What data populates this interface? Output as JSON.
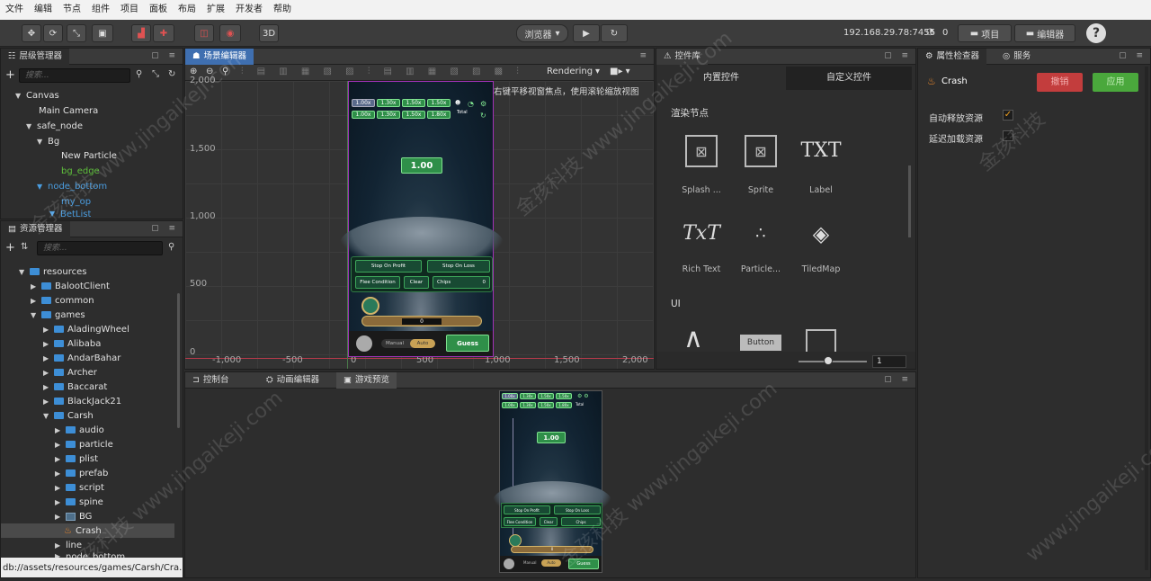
{
  "menu": [
    "文件",
    "编辑",
    "节点",
    "组件",
    "项目",
    "面板",
    "布局",
    "扩展",
    "开发者",
    "帮助"
  ],
  "toolbar": {
    "mode_3d": "3D",
    "browser_select": "浏览器",
    "ip_address": "192.168.29.78:7456",
    "connection_count": "0",
    "project_button": "项目",
    "editor_button": "编辑器"
  },
  "hierarchy": {
    "title": "层级管理器",
    "search_placeholder": "搜索...",
    "items": [
      {
        "label": "Canvas",
        "color": "white"
      },
      {
        "label": "Main Camera",
        "color": "white"
      },
      {
        "label": "safe_node",
        "color": "white"
      },
      {
        "label": "Bg",
        "color": "white"
      },
      {
        "label": "New Particle",
        "color": "white"
      },
      {
        "label": "bg_edge",
        "color": "green"
      },
      {
        "label": "node_bottom",
        "color": "blue"
      },
      {
        "label": "my_op",
        "color": "blue"
      },
      {
        "label": "BetList",
        "color": "blue"
      }
    ]
  },
  "assets": {
    "title": "资源管理器",
    "search_placeholder": "搜索...",
    "items": [
      {
        "label": "resources",
        "type": "folder"
      },
      {
        "label": "BalootClient",
        "type": "folder"
      },
      {
        "label": "common",
        "type": "folder"
      },
      {
        "label": "games",
        "type": "folder"
      },
      {
        "label": "AladingWheel",
        "type": "folder"
      },
      {
        "label": "Alibaba",
        "type": "folder"
      },
      {
        "label": "AndarBahar",
        "type": "folder"
      },
      {
        "label": "Archer",
        "type": "folder"
      },
      {
        "label": "Baccarat",
        "type": "folder"
      },
      {
        "label": "BlackJack21",
        "type": "folder"
      },
      {
        "label": "Carsh",
        "type": "folder"
      },
      {
        "label": "audio",
        "type": "folder"
      },
      {
        "label": "particle",
        "type": "folder"
      },
      {
        "label": "plist",
        "type": "folder"
      },
      {
        "label": "prefab",
        "type": "folder"
      },
      {
        "label": "script",
        "type": "folder"
      },
      {
        "label": "spine",
        "type": "folder"
      },
      {
        "label": "BG",
        "type": "image"
      },
      {
        "label": "Crash",
        "type": "scene"
      },
      {
        "label": "line",
        "type": "file"
      },
      {
        "label": "node_bottom",
        "type": "file"
      }
    ],
    "status_path": "db://assets/resources/games/Carsh/Cra..."
  },
  "scene": {
    "title": "场景编辑器",
    "rendering_label": "Rendering",
    "hint": "使用鼠标右键平移视窗焦点，使用滚轮缩放视图",
    "y_ticks": [
      "2,000",
      "1,500",
      "1,000",
      "500",
      "0"
    ],
    "x_ticks": [
      "-1,000",
      "-500",
      "0",
      "500",
      "1,000",
      "1,500",
      "2,000"
    ]
  },
  "game": {
    "multiplier": "1.00",
    "top_values_row1": [
      "1.00x",
      "1.30x",
      "1.50x",
      "1.50x"
    ],
    "top_values_row2": [
      "1.00x",
      "1.30x",
      "1.50x",
      "1.80x"
    ],
    "total_label": "Total",
    "stop_on_profit": "Stop On Profit",
    "stop_on_loss": "Stop On Loss",
    "flee_condition": "Flee Condition",
    "clear": "Clear",
    "chips_label": "Chips",
    "chips_value": "0",
    "bet_value": "0",
    "manual": "Manual",
    "auto": "Auto",
    "guess": "Guess"
  },
  "widgets": {
    "title": "控件库",
    "tab_builtin": "内置控件",
    "tab_custom": "自定义控件",
    "section_render": "渲染节点",
    "section_ui": "UI",
    "items": [
      "Splash ...",
      "Sprite",
      "Label",
      "Rich Text",
      "Particle...",
      "TiledMap"
    ],
    "label_glyph": "TXT",
    "richtext_glyph": "TxT",
    "button_glyph": "Button",
    "zoom_value": "1"
  },
  "bottom": {
    "tab_console": "控制台",
    "tab_animation": "动画编辑器",
    "tab_preview": "游戏预览"
  },
  "inspector": {
    "title": "属性检查器",
    "tab_service": "服务",
    "node_name": "Crash",
    "revert_button": "撤销",
    "apply_button": "应用",
    "auto_release_label": "自动释放资源",
    "auto_release_checked": true,
    "lazy_load_label": "延迟加载资源",
    "lazy_load_checked": false
  },
  "watermarks": [
    "金孩科技 www.jingaikeji.com",
    "金孩科技",
    "www.jingaikeji.com"
  ],
  "colors": {
    "accent_blue": "#3f6fb0",
    "revert_red": "#c33d3d",
    "apply_green": "#4aa83c",
    "tree_green": "#5fbf3c",
    "tree_blue": "#4a9de0"
  }
}
